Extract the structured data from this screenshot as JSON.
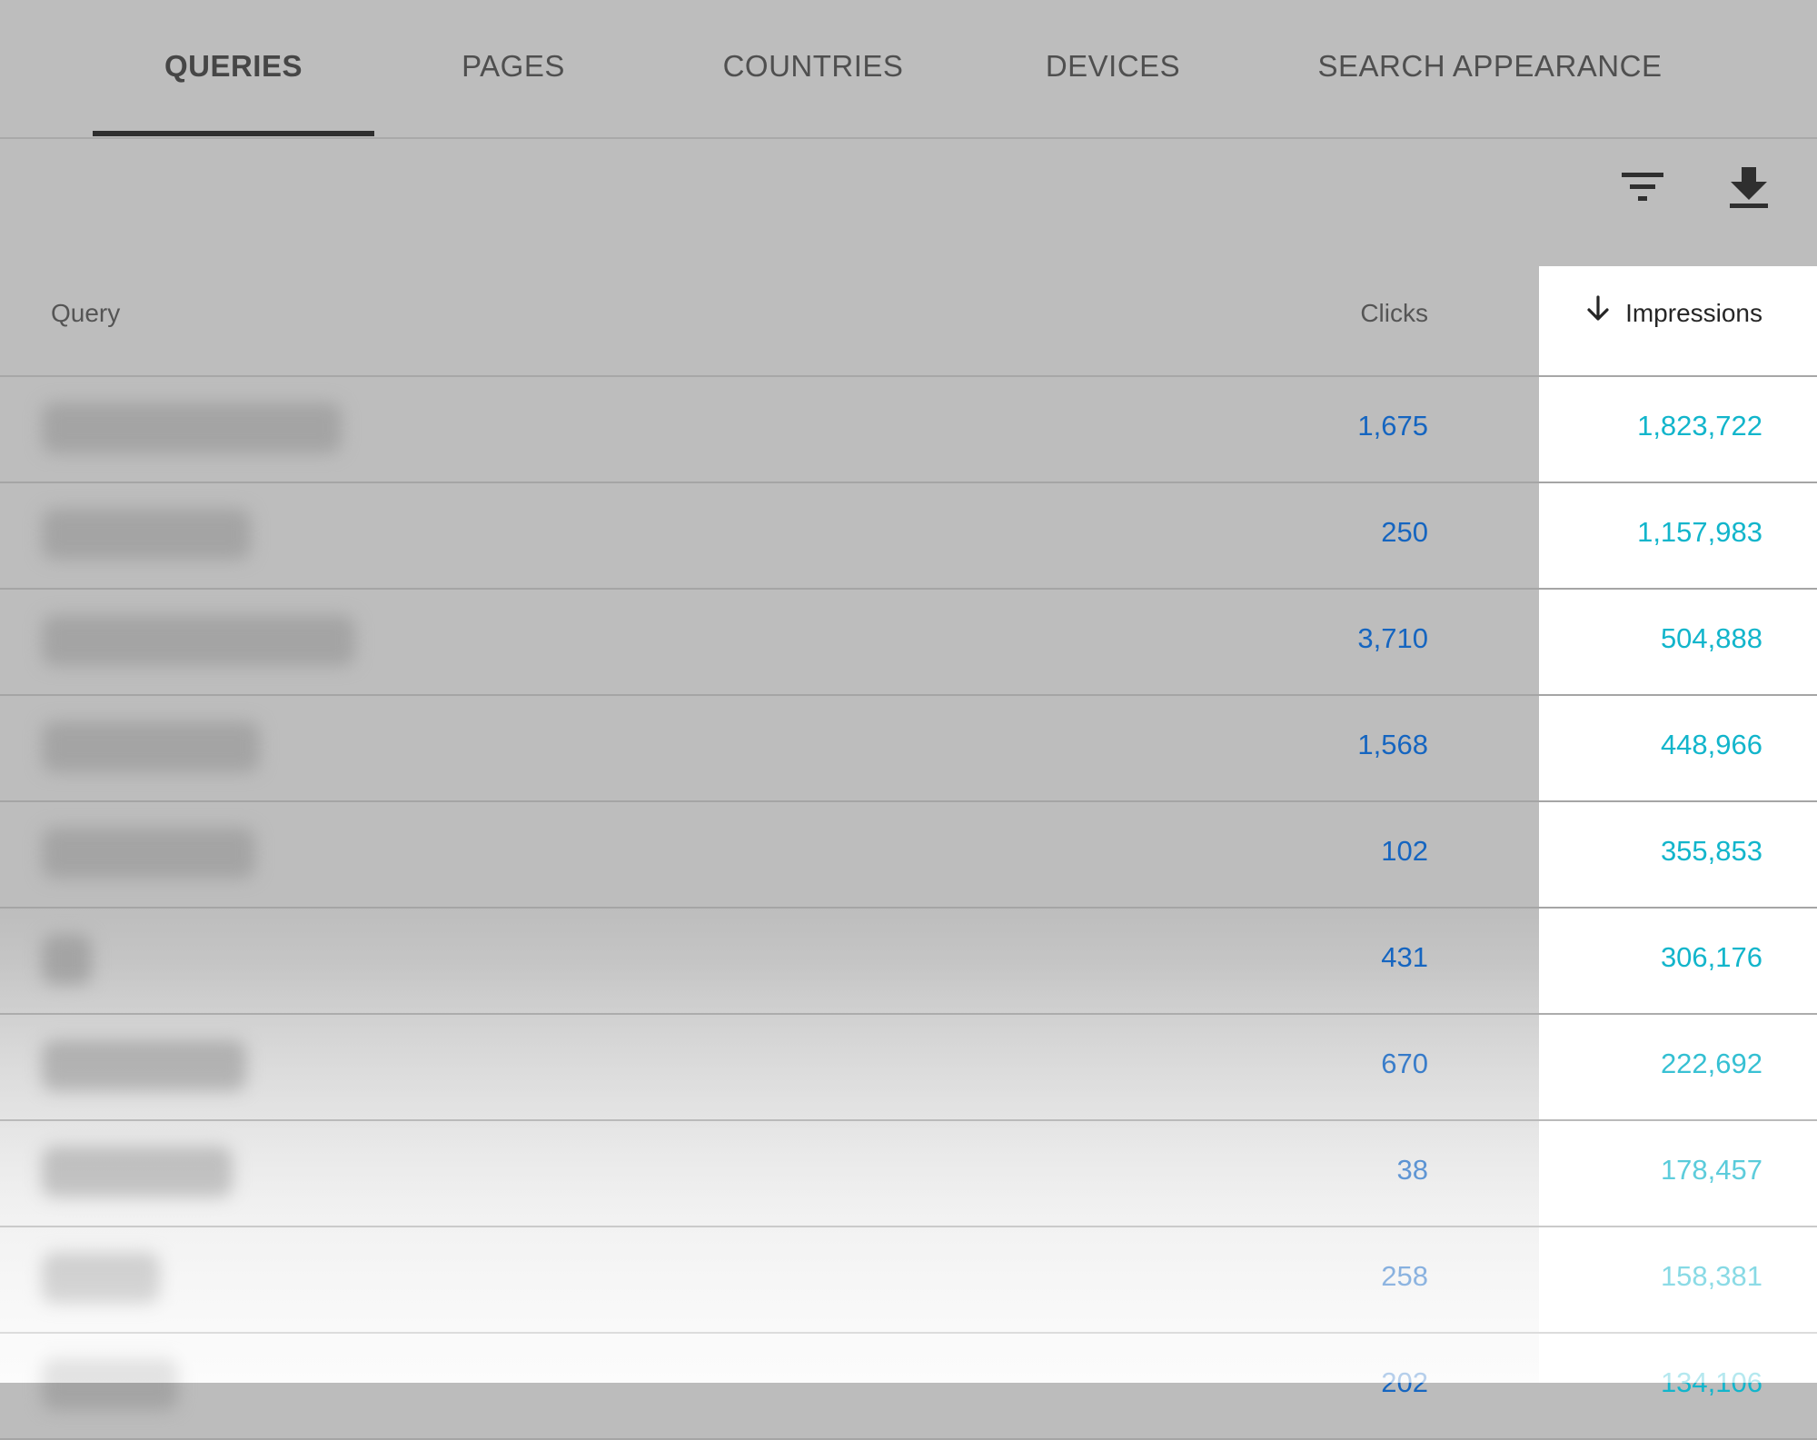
{
  "tabs": [
    {
      "label": "QUERIES",
      "active": true
    },
    {
      "label": "PAGES"
    },
    {
      "label": "COUNTRIES"
    },
    {
      "label": "DEVICES"
    },
    {
      "label": "SEARCH APPEARANCE"
    }
  ],
  "toolbar": {
    "filter_icon": "filter-icon",
    "download_icon": "download-icon"
  },
  "table": {
    "headers": {
      "query": "Query",
      "clicks": "Clicks",
      "impressions": "Impressions"
    },
    "sort": {
      "column": "impressions",
      "direction": "descending",
      "icon": "arrow-down-icon"
    },
    "rows": [
      {
        "query_blurred": true,
        "clicks": "1,675",
        "impressions": "1,823,722"
      },
      {
        "query_blurred": true,
        "clicks": "250",
        "impressions": "1,157,983"
      },
      {
        "query_blurred": true,
        "clicks": "3,710",
        "impressions": "504,888"
      },
      {
        "query_blurred": true,
        "clicks": "1,568",
        "impressions": "448,966"
      },
      {
        "query_blurred": true,
        "clicks": "102",
        "impressions": "355,853"
      },
      {
        "query_blurred": true,
        "clicks": "431",
        "impressions": "306,176"
      },
      {
        "query_blurred": true,
        "clicks": "670",
        "impressions": "222,692"
      },
      {
        "query_blurred": true,
        "clicks": "38",
        "impressions": "178,457"
      },
      {
        "query_blurred": true,
        "clicks": "258",
        "impressions": "158,381"
      },
      {
        "query_blurred": true,
        "clicks": "202",
        "impressions": "134,106"
      }
    ]
  },
  "colors": {
    "clicks": "#1565c0",
    "impressions": "#12b5cb",
    "active_tab_indicator": "#2e2e2e"
  }
}
